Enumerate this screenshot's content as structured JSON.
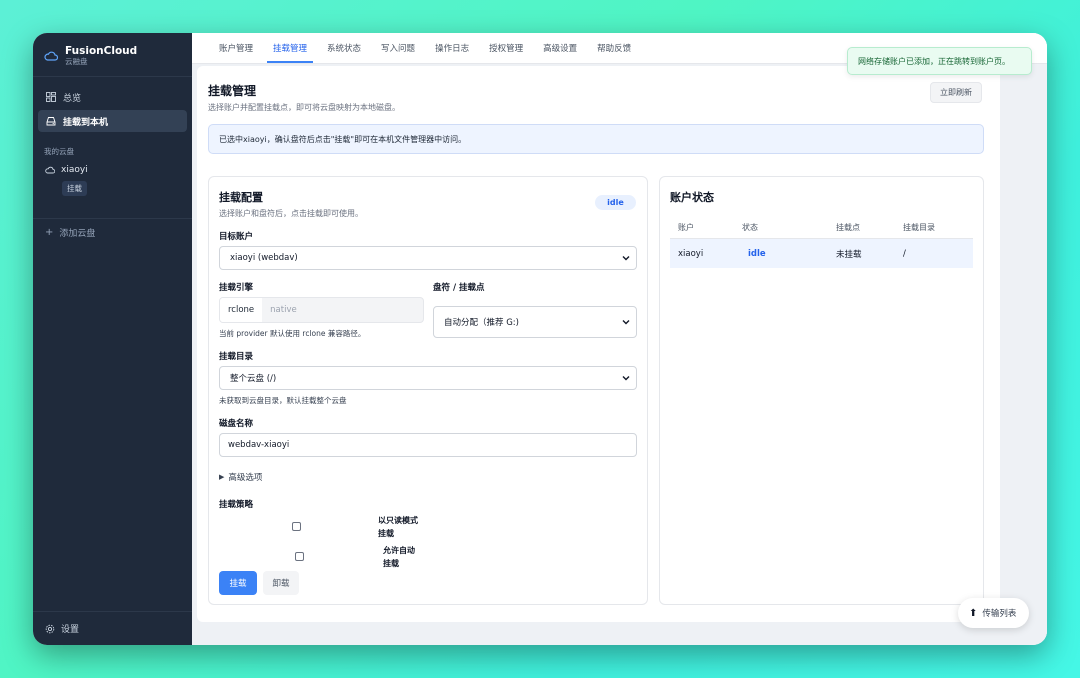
{
  "brand": {
    "title": "FusionCloud",
    "subtitle": "云融盘"
  },
  "sidebar": {
    "nav": [
      {
        "label": "总览",
        "icon": "dashboard-icon"
      },
      {
        "label": "挂载到本机",
        "icon": "drive-icon",
        "active": true
      }
    ],
    "section_label": "我的云盘",
    "clouds": [
      {
        "name": "xiaoyi",
        "badge": "挂载"
      }
    ],
    "add_cloud": "添加云盘",
    "footer_settings": "设置"
  },
  "tabs": [
    "账户管理",
    "挂载管理",
    "系统状态",
    "写入问题",
    "操作日志",
    "授权管理",
    "高级设置",
    "帮助反馈"
  ],
  "active_tab": "挂载管理",
  "page": {
    "title": "挂载管理",
    "description": "选择账户并配置挂载点，即可将云盘映射为本地磁盘。",
    "refresh_label": "立即刷新",
    "info": "已选中xiaoyi，确认盘符后点击\"挂载\"即可在本机文件管理器中访问。"
  },
  "config": {
    "title": "挂载配置",
    "subtitle": "选择账户和盘符后，点击挂载即可使用。",
    "status_pill": "idle",
    "target_account_label": "目标账户",
    "target_account_value": "xiaoyi (webdav)",
    "engine_label": "挂载引擎",
    "engine_options": [
      "rclone",
      "native"
    ],
    "engine_hint": "当前 provider 默认使用 rclone 兼容路径。",
    "drive_label": "盘符 / 挂载点",
    "drive_value": "自动分配（推荐 G:)",
    "dir_label": "挂载目录",
    "dir_value": "整个云盘 (/)",
    "dir_hint": "未获取到云盘目录，默认挂载整个云盘",
    "disk_name_label": "磁盘名称",
    "disk_name_value": "webdav-xiaoyi",
    "advanced_label": "高级选项",
    "strategy_label": "挂载策略",
    "readonly_line1": "以只读模式",
    "readonly_line2": "挂载",
    "autoload_line1": "允许自动",
    "autoload_line2": "挂载",
    "mount_button": "挂载",
    "unmount_button": "卸载"
  },
  "status": {
    "title": "账户状态",
    "columns": [
      "账户",
      "状态",
      "挂载点",
      "挂载目录"
    ],
    "rows": [
      {
        "account": "xiaoyi",
        "state": "idle",
        "mount_point": "未挂载",
        "mount_dir": "/"
      }
    ]
  },
  "toast": "网络存储账户已添加，正在跳转到账户页。",
  "transfer_label": "传输列表",
  "colors": {
    "accent": "#3b82f6",
    "sidebar_bg": "#1f2a3b",
    "toast_bg": "#e9fbf1"
  }
}
